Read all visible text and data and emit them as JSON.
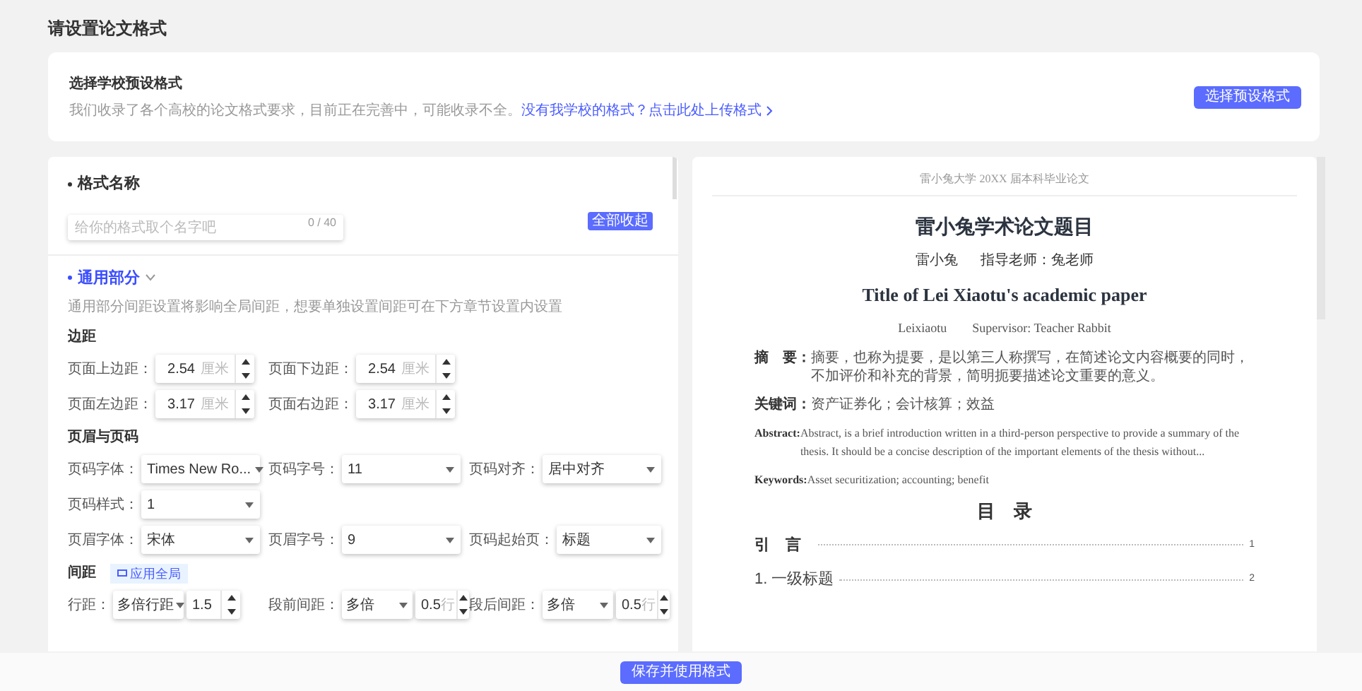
{
  "page_title": "请设置论文格式",
  "preset_card": {
    "title": "选择学校预设格式",
    "description": "我们收录了各个高校的论文格式要求，目前正在完善中，可能收录不全。",
    "link": "没有我学校的格式？点击此处上传格式",
    "button": "选择预设格式"
  },
  "name_section": {
    "title": "格式名称",
    "name_field": {
      "placeholder": "给你的格式取个名字吧",
      "counter": "0 / 40"
    },
    "collapse_button": "全部收起"
  },
  "general_section": {
    "title": "通用部分",
    "expanded": true,
    "note": "通用部分间距设置将影响全局间距，想要单独设置间距可在下方章节设置内设置",
    "groups": [
      {
        "heading": "边距",
        "rows": [
          [
            {
              "kind": "number",
              "label": "页面上边距：",
              "value": "2.54",
              "unit": "厘米"
            },
            {
              "kind": "number",
              "label": "页面下边距：",
              "value": "2.54",
              "unit": "厘米"
            }
          ],
          [
            {
              "kind": "number",
              "label": "页面左边距：",
              "value": "3.17",
              "unit": "厘米"
            },
            {
              "kind": "number",
              "label": "页面右边距：",
              "value": "3.17",
              "unit": "厘米"
            }
          ]
        ]
      },
      {
        "heading": "页眉与页码",
        "rows": [
          [
            {
              "kind": "select",
              "label": "页码字体：",
              "value": "Times New Ro..."
            },
            {
              "kind": "select",
              "label": "页码字号：",
              "value": "11"
            },
            {
              "kind": "select",
              "label": "页码对齐：",
              "value": "居中对齐"
            }
          ],
          [
            {
              "kind": "select",
              "label": "页码样式：",
              "value": "1"
            }
          ],
          [
            {
              "kind": "select",
              "label": "页眉字体：",
              "value": "宋体"
            },
            {
              "kind": "select",
              "label": "页眉字号：",
              "value": "9"
            },
            {
              "kind": "select",
              "label": "页码起始页：",
              "value": "标题"
            }
          ]
        ]
      },
      {
        "heading": "间距",
        "badge": "应用全局",
        "rows": [
          [
            {
              "kind": "combo",
              "label": "行距：",
              "select": "多倍行距",
              "value": "1.5"
            },
            {
              "kind": "combo",
              "label": "段前间距：",
              "select": "多倍",
              "value": "0.5",
              "unit": "行"
            },
            {
              "kind": "combo",
              "label": "段后间距：",
              "select": "多倍",
              "value": "0.5",
              "unit": "行"
            }
          ]
        ]
      }
    ]
  },
  "preview": {
    "header": "雷小兔大学 20XX 届本科毕业论文",
    "title": "雷小兔学术论文题目",
    "author": "雷小兔",
    "supervisor": "指导老师：兔老师",
    "title_en": "Title of Lei Xiaotu's academic paper",
    "author_en": "Leixiaotu",
    "supervisor_en": "Supervisor: Teacher Rabbit",
    "entries": [
      {
        "kind": "cn",
        "label": "摘　要：",
        "text": "摘要，也称为提要，是以第三人称撰写，在简述论文内容概要的同时，不加评价和补充的背景，简明扼要描述论文重要的意义。"
      },
      {
        "kind": "cn",
        "label": "关键词：",
        "text": "资产证券化；会计核算；效益"
      },
      {
        "kind": "en",
        "label": "Abstract:",
        "text": "Abstract, is a brief introduction written in a third-person perspective to provide a summary of the thesis. It should be a concise description of the important elements of the thesis without..."
      },
      {
        "kind": "en",
        "label": "Keywords:",
        "text": "Asset securitization; accounting; benefit"
      }
    ],
    "toc_title": "目　录",
    "toc": [
      {
        "kind": "chapter",
        "title": "引　言",
        "page": "1"
      },
      {
        "kind": "heading",
        "title": "1. 一级标题",
        "page": "2"
      }
    ]
  },
  "save_button": "保存并使用格式"
}
